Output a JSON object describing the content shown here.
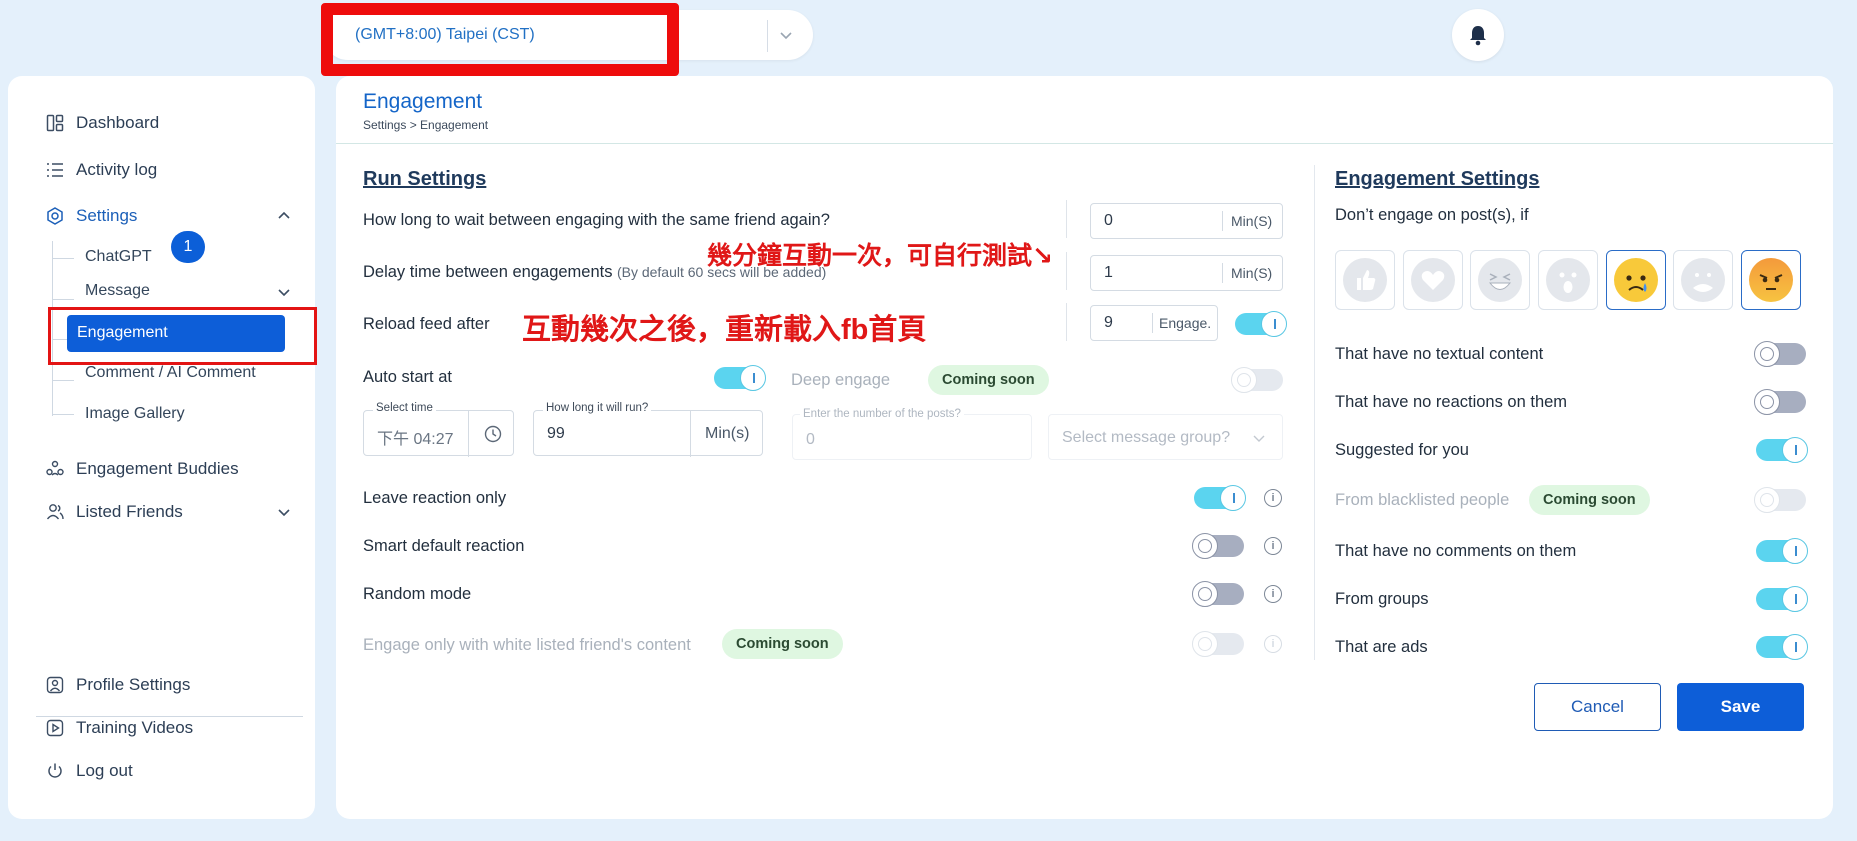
{
  "header": {
    "timezone_value": "(GMT+8:00) Taipei (CST)",
    "notifications_icon": "bell-icon"
  },
  "sidebar": {
    "dashboard": "Dashboard",
    "activity_log": "Activity log",
    "activity_log_count": "1",
    "settings": "Settings",
    "settings_children": {
      "chatgpt": "ChatGPT",
      "message": "Message",
      "engagement": "Engagement",
      "comment": "Comment / AI Comment",
      "gallery": "Image Gallery"
    },
    "engagement_buddies": "Engagement Buddies",
    "listed_friends": "Listed Friends",
    "profile_settings": "Profile Settings",
    "training_videos": "Training Videos",
    "log_out": "Log out"
  },
  "page": {
    "title": "Engagement",
    "breadcrumb": "Settings > Engagement"
  },
  "run_settings": {
    "title": "Run Settings",
    "wait_same_friend": {
      "label": "How long to wait between engaging with the same friend again?",
      "value": "0",
      "unit": "Min(S)"
    },
    "delay_between": {
      "label": "Delay time between engagements",
      "note": "(By default 60 secs will be added)",
      "value": "1",
      "unit": "Min(S)"
    },
    "reload_feed": {
      "label": "Reload feed after",
      "value": "9",
      "unit": "Engage.",
      "enabled": true
    },
    "auto_start": {
      "label": "Auto start at",
      "enabled": true,
      "time_label": "Select time",
      "time_value": "下午 04:27",
      "duration_label": "How long it will run?",
      "duration_value": "99",
      "duration_unit": "Min(s)"
    },
    "deep_engage": {
      "label": "Deep engage",
      "badge": "Coming soon",
      "enabled": false,
      "posts_label": "Enter the number of the posts?",
      "posts_value": "0",
      "group_placeholder": "Select message group?"
    },
    "leave_reaction_only": {
      "label": "Leave reaction only",
      "enabled": true
    },
    "smart_default_reaction": {
      "label": "Smart default reaction",
      "enabled": false
    },
    "random_mode": {
      "label": "Random mode",
      "enabled": false
    },
    "white_listed_only": {
      "label": "Engage only with white listed friend's content",
      "badge": "Coming soon",
      "enabled": false
    }
  },
  "annotations": {
    "delay_note": "幾分鐘互動一次，可自行測試↘",
    "reload_note": "互動幾次之後，重新載入fb首頁"
  },
  "engagement_settings": {
    "title": "Engagement Settings",
    "subtitle": "Don’t engage on post(s), if",
    "reactions": [
      {
        "name": "like",
        "selected": false
      },
      {
        "name": "love",
        "selected": false
      },
      {
        "name": "haha",
        "selected": false
      },
      {
        "name": "wow",
        "selected": false
      },
      {
        "name": "sad",
        "selected": true
      },
      {
        "name": "care",
        "selected": false
      },
      {
        "name": "angry",
        "selected": true
      }
    ],
    "options": {
      "no_text": {
        "label": "That have no textual content",
        "enabled": false
      },
      "no_reactions": {
        "label": "That have no reactions on them",
        "enabled": false
      },
      "suggested": {
        "label": "Suggested for you",
        "enabled": true
      },
      "blacklisted": {
        "label": "From blacklisted people",
        "badge": "Coming soon",
        "enabled": false
      },
      "no_comments": {
        "label": "That have no comments on them",
        "enabled": true
      },
      "groups": {
        "label": "From groups",
        "enabled": true
      },
      "ads": {
        "label": "That are ads",
        "enabled": true
      }
    }
  },
  "actions": {
    "cancel": "Cancel",
    "save": "Save"
  },
  "colors": {
    "accent": "#0d5ed8",
    "toggle_on": "#5bd4ef",
    "annotation_red": "#e01717",
    "badge_green": "#dff7e1"
  }
}
